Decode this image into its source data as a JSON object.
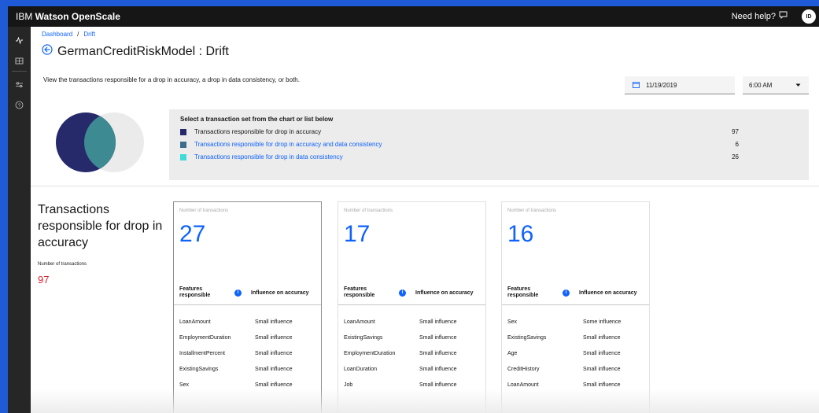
{
  "header": {
    "brand_prefix": "IBM ",
    "brand_name": "Watson OpenScale",
    "help_label": "Need help?",
    "avatar_initials": "ID"
  },
  "breadcrumb": {
    "items": [
      "Dashboard",
      "Drift"
    ],
    "separator": "/"
  },
  "page": {
    "title": "GermanCreditRiskModel : Drift",
    "description": "View the transactions responsible for a drop in accuracy, a drop in data consistency, or both."
  },
  "filters": {
    "date": "11/19/2019",
    "time": "6:00 AM"
  },
  "selector": {
    "heading": "Select a transaction set from the chart or list below",
    "items": [
      {
        "label": "Transactions responsible for drop in accuracy",
        "count": "97",
        "color": "#262a6b",
        "text_color": "#161616"
      },
      {
        "label": "Transactions responsible for drop in accuracy and data consistency",
        "count": "6",
        "color": "#3d6d8a",
        "text_color": "#0f62fe"
      },
      {
        "label": "Transactions responsible for drop in data consistency",
        "count": "26",
        "color": "#3ddbd9",
        "text_color": "#0f62fe"
      }
    ]
  },
  "summary": {
    "title": "Transactions responsible for drop in accuracy",
    "sublabel": "Number of transactions",
    "count": "97"
  },
  "cards": [
    {
      "title": "Number of transactions",
      "count": "27",
      "features_header": "Features responsible",
      "influence_header": "Influence on accuracy",
      "rows": [
        {
          "feature": "LoanAmount",
          "influence": "Small influence"
        },
        {
          "feature": "EmploymentDuration",
          "influence": "Small influence"
        },
        {
          "feature": "InstallmentPercent",
          "influence": "Small influence"
        },
        {
          "feature": "ExistingSavings",
          "influence": "Small influence"
        },
        {
          "feature": "Sex",
          "influence": "Small influence"
        }
      ]
    },
    {
      "title": "Number of transactions",
      "count": "17",
      "features_header": "Features responsible",
      "influence_header": "Influence on accuracy",
      "rows": [
        {
          "feature": "LoanAmount",
          "influence": "Small influence"
        },
        {
          "feature": "ExistingSavings",
          "influence": "Small influence"
        },
        {
          "feature": "EmploymentDuration",
          "influence": "Small influence"
        },
        {
          "feature": "LoanDuration",
          "influence": "Small influence"
        },
        {
          "feature": "Job",
          "influence": "Small influence"
        }
      ]
    },
    {
      "title": "Number of transactions",
      "count": "16",
      "features_header": "Features responsible",
      "influence_header": "Influence on accuracy",
      "rows": [
        {
          "feature": "Sex",
          "influence": "Some influence"
        },
        {
          "feature": "ExistingSavings",
          "influence": "Small influence"
        },
        {
          "feature": "Age",
          "influence": "Small influence"
        },
        {
          "feature": "CreditHistory",
          "influence": "Small influence"
        },
        {
          "feature": "LoanAmount",
          "influence": "Small influence"
        }
      ]
    }
  ],
  "icons": {
    "sidebar": [
      "activity-icon",
      "table-icon",
      "settings-adjust-icon",
      "help-icon"
    ],
    "header": [
      "chat-help-icon"
    ],
    "title": [
      "back-arrow-icon"
    ],
    "date": "calendar-icon",
    "time": "chevron-down-icon",
    "info": "information-icon"
  },
  "colors": {
    "brand_blue": "#0f62fe",
    "accent_red": "#da1e28",
    "venn_left": "#262a6b",
    "venn_overlap": "#3d8a92",
    "venn_right": "#ebebeb"
  }
}
